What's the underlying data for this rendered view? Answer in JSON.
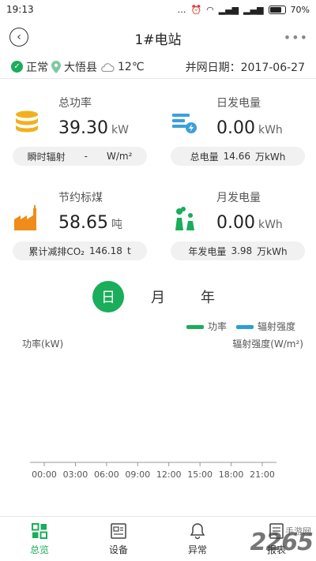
{
  "status_bar": {
    "time": "19:13",
    "dots": "…",
    "battery_text": "70%"
  },
  "header": {
    "title": "1#电站",
    "back_icon": "‹",
    "more_icon": "•••"
  },
  "info": {
    "status": "正常",
    "location": "大悟县",
    "temperature": "12℃",
    "grid_date_label": "并网日期：",
    "grid_date": "2017-06-27"
  },
  "cards": {
    "total_power": {
      "label": "总功率",
      "value": "39.30",
      "unit": "kW",
      "sub_label": "瞬时辐射",
      "sub_value": "-",
      "sub_unit": "W/m²"
    },
    "daily_gen": {
      "label": "日发电量",
      "value": "0.00",
      "unit": "kWh",
      "sub_label": "总电量",
      "sub_value": "14.66",
      "sub_unit": "万kWh"
    },
    "coal_saved": {
      "label": "节约标煤",
      "value": "58.65",
      "unit": "吨",
      "sub_label": "累计减排CO₂",
      "sub_value": "146.18",
      "sub_unit": "t"
    },
    "monthly_gen": {
      "label": "月发电量",
      "value": "0.00",
      "unit": "kWh",
      "sub_label": "年发电量",
      "sub_value": "3.98",
      "sub_unit": "万kWh"
    }
  },
  "period_tabs": [
    "日",
    "月",
    "年"
  ],
  "period_selected": "日",
  "legend": {
    "power": "功率",
    "irradiance": "辐射强度"
  },
  "colors": {
    "accent": "#1aad5a",
    "power_series": "#1aad5a",
    "irradiance_series": "#2a9fd6",
    "icon_yellow": "#f2b01e",
    "icon_orange": "#f08c1a",
    "icon_blue": "#3aa0dc"
  },
  "chart_data": {
    "type": "line",
    "ylabel": "功率(kW)",
    "y2label": "辐射强度(W/m²)",
    "categories": [
      "00:00",
      "03:00",
      "06:00",
      "09:00",
      "12:00",
      "15:00",
      "18:00",
      "21:00"
    ],
    "series": [
      {
        "name": "功率",
        "values": []
      },
      {
        "name": "辐射强度",
        "values": []
      }
    ],
    "grid": false,
    "legend_position": "top-right"
  },
  "nav": [
    {
      "label": "总览",
      "icon": "overview-icon"
    },
    {
      "label": "设备",
      "icon": "device-icon"
    },
    {
      "label": "异常",
      "icon": "alarm-bell-icon"
    },
    {
      "label": "报表",
      "icon": "report-icon"
    }
  ],
  "watermark": {
    "main": "2265",
    "sub": "手游网"
  }
}
